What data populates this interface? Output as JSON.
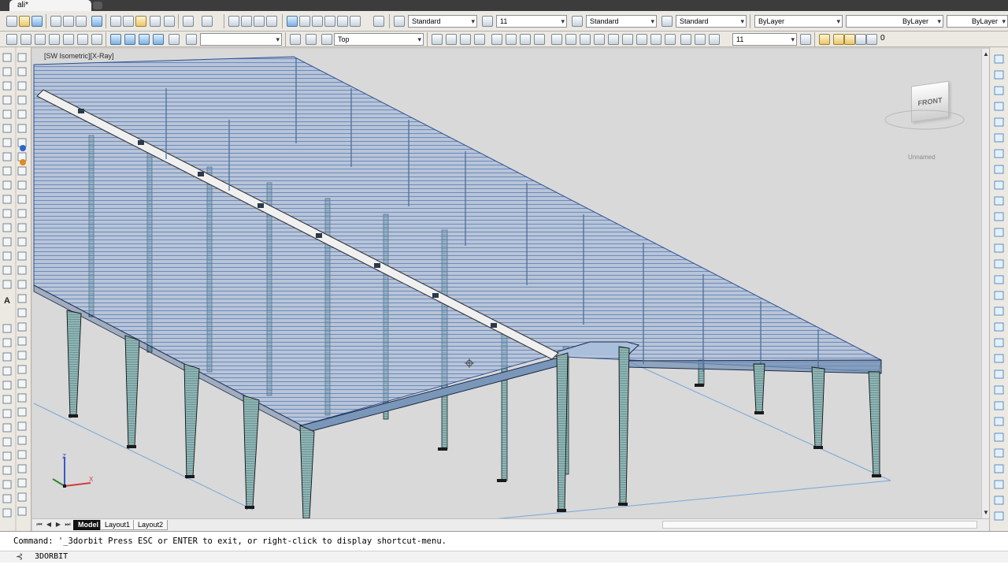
{
  "window": {
    "doc_tab_title": "ali*"
  },
  "toolbar": {
    "text_style": "Standard",
    "text_height": "11",
    "dim_style": "Standard",
    "table_style": "Standard",
    "layer_color": "ByLayer",
    "linetype": "ByLayer",
    "lineweight": "ByLayer",
    "view_name": "Top",
    "ucs_value": "11",
    "layer_number": "0"
  },
  "viewport": {
    "label": "[SW Isometric][X-Ray]",
    "viewcube_face": "FRONT",
    "ucs_label": "Unnamed",
    "axis_z_label": "Z"
  },
  "layout_tabs": [
    "Model",
    "Layout1",
    "Layout2"
  ],
  "command": {
    "history": "Command: '_3dorbit Press ESC or ENTER to exit, or right-click to display shortcut-menu.",
    "current": "3DORBIT"
  },
  "colors": {
    "roof": "#4a73b5",
    "steel": "#7aa3a3",
    "viewport_bg": "#d9d9d9",
    "ucs_x": "#d23c3c",
    "ucs_y": "#2a8a2a",
    "ucs_z": "#3a58c8"
  },
  "icons": [
    "new-icon",
    "open-icon",
    "save-icon",
    "print-icon",
    "undo-icon",
    "redo-icon",
    "pan-icon",
    "zoom-icon",
    "line-icon",
    "circle-icon",
    "orbit-icon",
    "layer-icon"
  ]
}
